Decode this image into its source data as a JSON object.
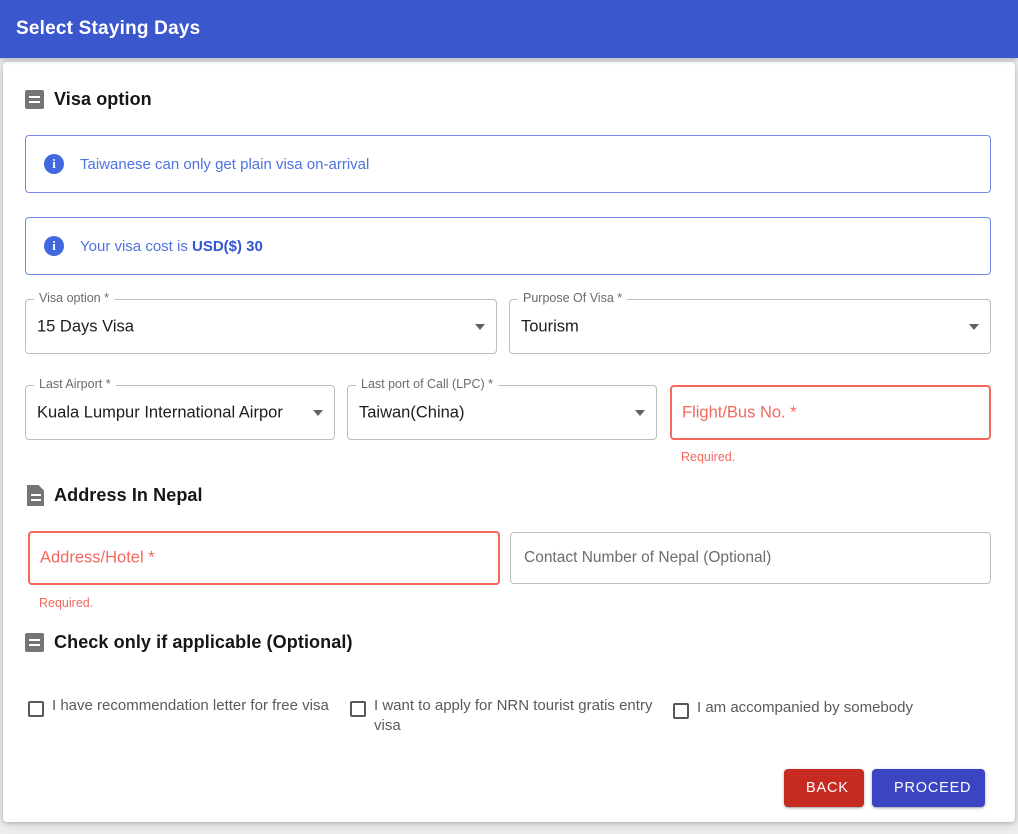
{
  "header": {
    "title": "Select Staying Days"
  },
  "colors": {
    "header_blue": "#3b57ce",
    "info_blue": "#4d72e0",
    "error_red": "#f4685e",
    "back_red": "#c62b22",
    "proceed_blue": "#3b45c2",
    "icon_grey": "#757575"
  },
  "visa_section": {
    "title": "Visa option",
    "icon": "subject-icon",
    "alerts": [
      {
        "icon": "info-icon",
        "text": "Taiwanese can only get plain visa on-arrival"
      },
      {
        "icon": "info-icon",
        "text_prefix": "Your visa cost is ",
        "text_bold": "USD($) 30"
      }
    ],
    "fields": [
      {
        "label": "Visa option *",
        "value": "15 Days Visa",
        "type": "select"
      },
      {
        "label": "Purpose Of Visa *",
        "value": "Tourism",
        "type": "select"
      },
      {
        "label": "Last Airport *",
        "value": "Kuala Lumpur International Airpor",
        "type": "select"
      },
      {
        "label": "Last port of Call (LPC) *",
        "value": "Taiwan(China)",
        "type": "select"
      }
    ],
    "flight_field": {
      "placeholder": "Flight/Bus No. *",
      "value": "",
      "error": "Required."
    }
  },
  "address_section": {
    "title": "Address In Nepal",
    "icon": "article-icon",
    "address_field": {
      "placeholder": "Address/Hotel *",
      "value": "",
      "error": "Required."
    },
    "contact_field": {
      "placeholder": "Contact Number of Nepal (Optional)",
      "value": ""
    }
  },
  "optional_section": {
    "title": "Check only if applicable (Optional)",
    "icon": "subject-icon",
    "checkboxes": [
      {
        "label": "I have recommendation letter for free visa",
        "checked": false
      },
      {
        "label": "I want to apply for NRN tourist gratis entry visa",
        "checked": false
      },
      {
        "label": "I am accompanied by somebody",
        "checked": false
      }
    ]
  },
  "footer": {
    "back_label": "BACK",
    "proceed_label": "PROCEED"
  }
}
